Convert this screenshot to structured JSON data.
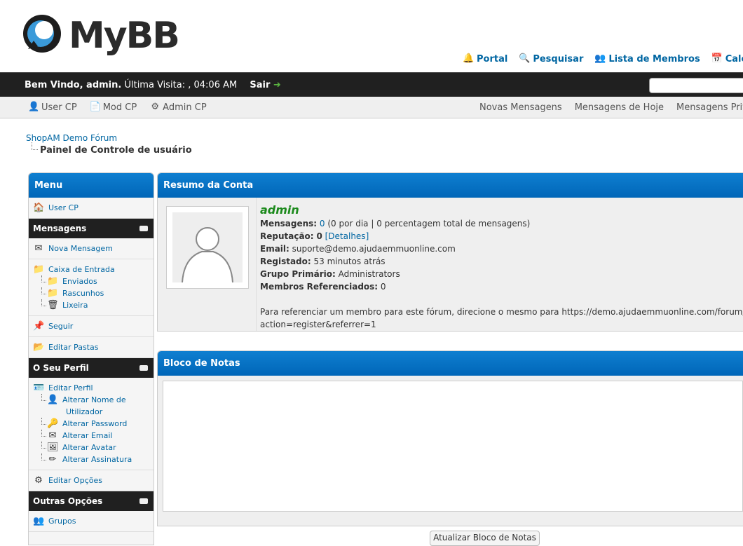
{
  "brand": {
    "logo_text": "MyBB"
  },
  "top_links": [
    {
      "icon": "bell-icon",
      "label": "Portal"
    },
    {
      "icon": "magnifier-icon",
      "label": "Pesquisar"
    },
    {
      "icon": "members-icon",
      "label": "Lista de Membros"
    },
    {
      "icon": "calendar-icon",
      "label": "Calendá"
    }
  ],
  "welcome": {
    "greeting": "Bem Vindo, admin.",
    "last_visit": "Última Visita: , 04:06 AM",
    "logout": "Sair"
  },
  "subnav": {
    "left": [
      {
        "label": "User CP"
      },
      {
        "label": "Mod CP"
      },
      {
        "label": "Admin CP"
      }
    ],
    "right": [
      {
        "label": "Novas Mensagens"
      },
      {
        "label": "Mensagens de Hoje"
      },
      {
        "label": "Mensagens Privadas ("
      }
    ]
  },
  "breadcrumb": {
    "forum": "ShopAM Demo Fórum",
    "current": "Painel de Controle de usuário"
  },
  "menu": {
    "title": "Menu",
    "usercp": "User CP",
    "sections": {
      "messages": "Mensagens",
      "profile": "O Seu Perfil",
      "other": "Outras Opções"
    },
    "items": {
      "new_message": "Nova Mensagem",
      "inbox": "Caixa de Entrada",
      "sent": "Enviados",
      "drafts": "Rascunhos",
      "trash": "Lixeira",
      "follow": "Seguir",
      "edit_folders": "Editar Pastas",
      "edit_profile": "Editar Perfil",
      "change_name_1": "Alterar Nome de",
      "change_name_2": "Utilizador",
      "change_password": "Alterar Password",
      "change_email": "Alterar Email",
      "change_avatar": "Alterar Avatar",
      "change_signature": "Alterar Assinatura",
      "edit_options": "Editar Opções",
      "groups": "Grupos"
    }
  },
  "summary": {
    "title": "Resumo da Conta",
    "username": "admin",
    "posts_label": "Mensagens:",
    "posts_value": "0",
    "posts_rest": "(0 por dia | 0 percentagem total de mensagens)",
    "rep_label": "Reputação:",
    "rep_value": "0",
    "rep_details": "[Detalhes]",
    "email_label": "Email:",
    "email_value": "suporte@demo.ajudaemmuonline.com",
    "registered_label": "Registado:",
    "registered_value": "53 minutos atrás",
    "group_label": "Grupo Primário:",
    "group_value": "Administrators",
    "referred_label": "Membros Referenciados:",
    "referred_value": "0",
    "referral_line1": "Para referenciar um membro para este fórum, direcione o mesmo para https://demo.ajudaemmuonline.com/forum/mem",
    "referral_line2": "action=register&referrer=1"
  },
  "notepad": {
    "title": "Bloco de Notas",
    "button": "Atualizar Bloco de Notas"
  }
}
